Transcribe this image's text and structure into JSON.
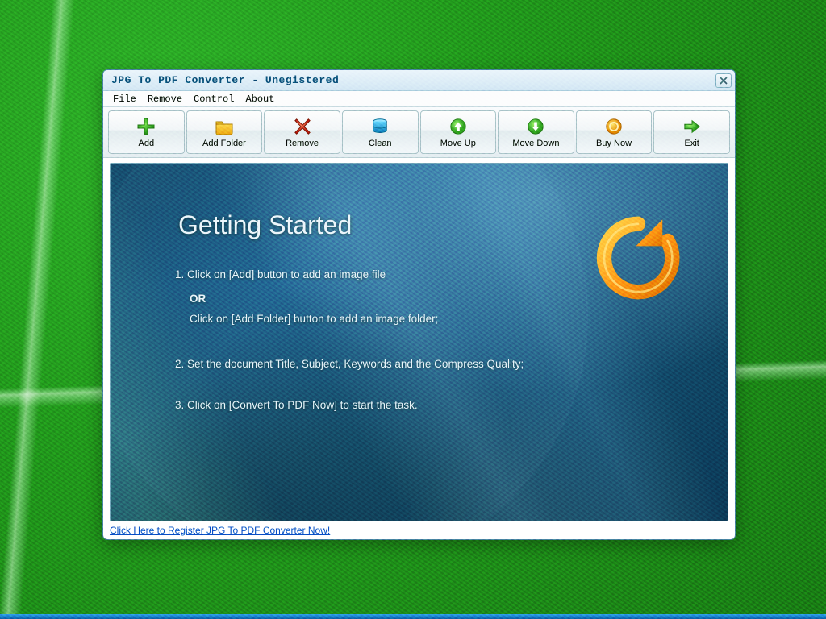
{
  "window": {
    "title": "JPG To PDF Converter - Unegistered"
  },
  "menu": {
    "items": [
      "File",
      "Remove",
      "Control",
      "About"
    ]
  },
  "toolbar": {
    "buttons": [
      {
        "id": "add",
        "label": "Add",
        "icon": "plus-icon"
      },
      {
        "id": "add-folder",
        "label": "Add Folder",
        "icon": "folder-icon"
      },
      {
        "id": "remove",
        "label": "Remove",
        "icon": "x-red-icon"
      },
      {
        "id": "clean",
        "label": "Clean",
        "icon": "database-icon"
      },
      {
        "id": "move-up",
        "label": "Move Up",
        "icon": "arrow-up-icon"
      },
      {
        "id": "move-down",
        "label": "Move Down",
        "icon": "arrow-down-icon"
      },
      {
        "id": "buy-now",
        "label": "Buy Now",
        "icon": "coin-icon"
      },
      {
        "id": "exit",
        "label": "Exit",
        "icon": "arrow-right-icon"
      }
    ]
  },
  "content": {
    "heading": "Getting Started",
    "step1a": "1. Click on [Add] button to add an image file",
    "or": "OR",
    "step1b": "Click on [Add Folder] button to add an image folder;",
    "step2": "2. Set the document Title, Subject, Keywords and the Compress Quality;",
    "step3": "3. Click on [Convert To PDF Now] to start the task."
  },
  "footer": {
    "register_link": "Click Here to Register JPG To PDF Converter Now!"
  }
}
